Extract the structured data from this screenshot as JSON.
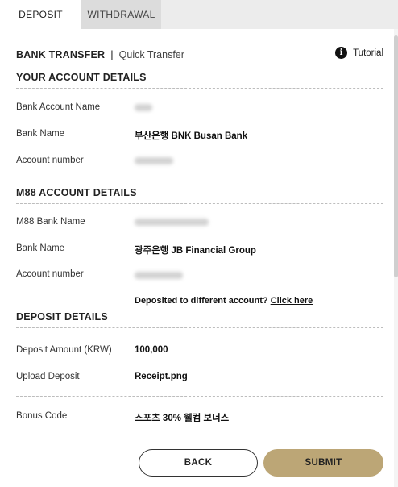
{
  "tabs": [
    {
      "label": "DEPOSIT",
      "active": true
    },
    {
      "label": "WITHDRAWAL",
      "active": false
    }
  ],
  "breadcrumb": {
    "main": "BANK TRANSFER",
    "separator": "|",
    "sub": "Quick Transfer"
  },
  "tutorial": {
    "icon": "info-icon",
    "icon_glyph": "i",
    "label": "Tutorial"
  },
  "your_account": {
    "title": "YOUR ACCOUNT DETAILS",
    "rows": [
      {
        "label": "Bank Account Name",
        "value": "",
        "redacted": true
      },
      {
        "label": "Bank Name",
        "value": "부산은행 BNK Busan Bank"
      },
      {
        "label": "Account number",
        "value": "",
        "redacted": true
      }
    ]
  },
  "m88_account": {
    "title": "M88 ACCOUNT DETAILS",
    "rows": [
      {
        "label": "M88 Bank Name",
        "value": "",
        "redacted": true
      },
      {
        "label": "Bank Name",
        "value": "광주은행 JB Financial Group"
      },
      {
        "label": "Account number",
        "value": "",
        "redacted": true
      }
    ],
    "different_account_text": "Deposited to different account?",
    "different_account_link": "Click here"
  },
  "deposit_details": {
    "title": "DEPOSIT DETAILS",
    "rows": [
      {
        "label": "Deposit Amount (KRW)",
        "value": "100,000"
      },
      {
        "label": "Upload Deposit",
        "value": "Receipt.png"
      },
      {
        "label": "Bonus Code",
        "value": "스포츠 30% 웰컴 보너스"
      }
    ]
  },
  "buttons": {
    "back": "BACK",
    "submit": "SUBMIT"
  },
  "colors": {
    "accent": "#bca676",
    "tab_bar": "#ececec"
  }
}
